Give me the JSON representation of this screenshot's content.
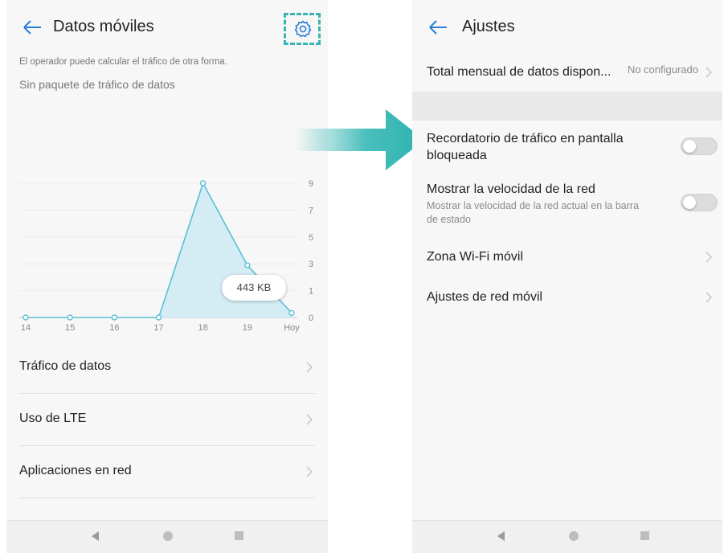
{
  "left_screen": {
    "title": "Datos móviles",
    "note": "El operador puede calcular el tráfico de otra forma.",
    "subnote": "Sin paquete de tráfico de datos",
    "usage_bubble": "443 KB",
    "menu": [
      {
        "label": "Tráfico de datos"
      },
      {
        "label": "Uso de LTE"
      },
      {
        "label": "Aplicaciones en red"
      }
    ]
  },
  "chart_data": {
    "type": "area",
    "categories": [
      "14",
      "15",
      "16",
      "17",
      "18",
      "19",
      "Hoy"
    ],
    "values": [
      0,
      0,
      0,
      0,
      9,
      3.5,
      0.3
    ],
    "y_ticks": [
      "9",
      "7",
      "5",
      "3",
      "1",
      "0"
    ],
    "ylim": [
      0,
      9
    ],
    "color": "#5bbfd6",
    "fill": "#cfeaf3"
  },
  "right_screen": {
    "title": "Ajustes",
    "total_label": "Total mensual de datos dispon...",
    "total_value": "No configurado",
    "lock_reminder": "Recordatorio de tráfico en pantalla bloqueada",
    "speed_label": "Mostrar la velocidad de la red",
    "speed_sub": "Mostrar la velocidad de la red actual en la barra de estado",
    "hotspot": "Zona Wi-Fi móvil",
    "mobile_net": "Ajustes de red móvil"
  },
  "toggles": {
    "lock_reminder": false,
    "network_speed": false
  },
  "colors": {
    "accent": "#3bb3b3",
    "arrow": "#2bb3b0"
  },
  "icons": [
    "back-arrow-icon",
    "gear-icon",
    "chevron-right-icon",
    "nav-back-icon",
    "nav-home-icon",
    "nav-recent-icon"
  ]
}
